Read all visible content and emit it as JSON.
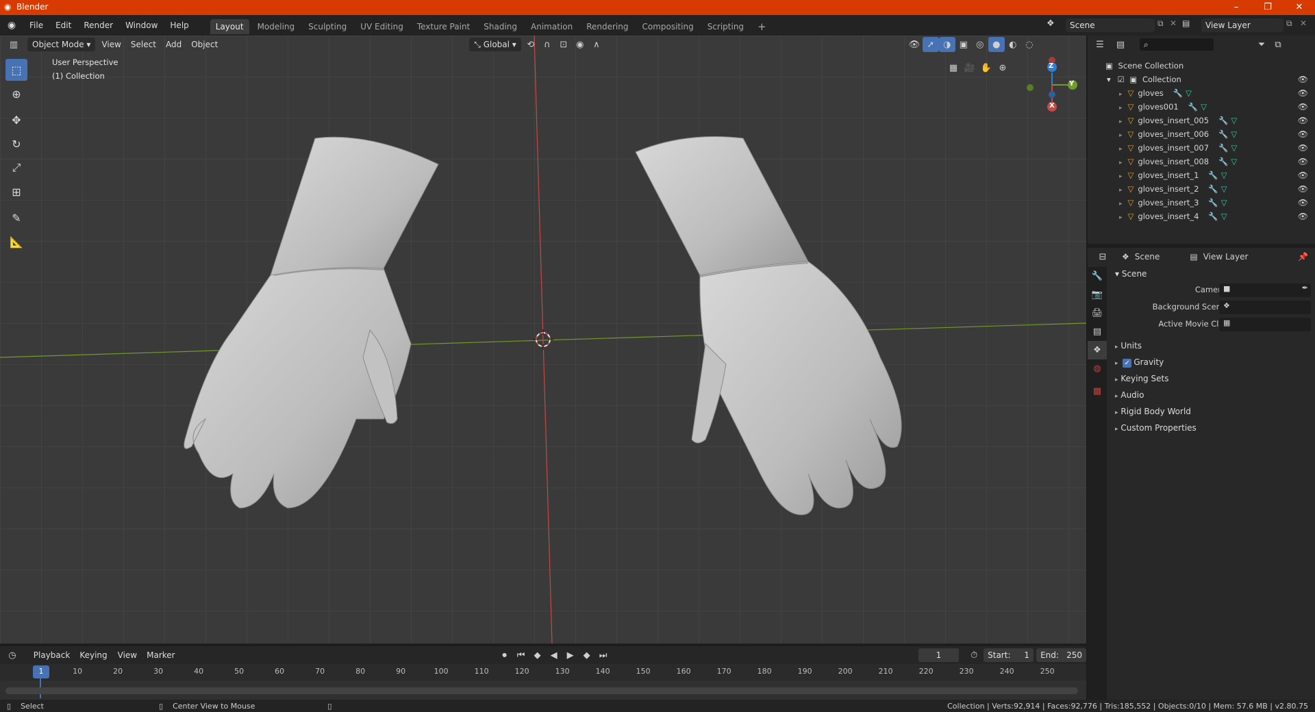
{
  "window": {
    "title": "Blender",
    "controls": [
      "–",
      "❐",
      "✕"
    ]
  },
  "menu": [
    "File",
    "Edit",
    "Render",
    "Window",
    "Help"
  ],
  "workspaces": [
    {
      "label": "Layout",
      "active": true
    },
    {
      "label": "Modeling"
    },
    {
      "label": "Sculpting"
    },
    {
      "label": "UV Editing"
    },
    {
      "label": "Texture Paint"
    },
    {
      "label": "Shading"
    },
    {
      "label": "Animation"
    },
    {
      "label": "Rendering"
    },
    {
      "label": "Compositing"
    },
    {
      "label": "Scripting"
    }
  ],
  "add_workspace": "+",
  "scene_field": "Scene",
  "view_layer_field": "View Layer",
  "viewport": {
    "mode": "Object Mode",
    "menus": [
      "View",
      "Select",
      "Add",
      "Object"
    ],
    "orientation": "Global",
    "info_line1": "User Perspective",
    "info_line2": "(1) Collection",
    "gizmo": {
      "z": "Z",
      "y": "Y",
      "x": "X"
    }
  },
  "outliner": {
    "root": "Scene Collection",
    "collection": "Collection",
    "items": [
      "gloves",
      "gloves001",
      "gloves_insert_005",
      "gloves_insert_006",
      "gloves_insert_007",
      "gloves_insert_008",
      "gloves_insert_1",
      "gloves_insert_2",
      "gloves_insert_3",
      "gloves_insert_4"
    ]
  },
  "properties": {
    "header_scene": "Scene",
    "header_view_layer": "View Layer",
    "section": "Scene",
    "rows": [
      {
        "label": "Camera"
      },
      {
        "label": "Background Scene"
      },
      {
        "label": "Active Movie Clip"
      }
    ],
    "subsections": [
      {
        "label": "Units",
        "check": false
      },
      {
        "label": "Gravity",
        "check": true
      },
      {
        "label": "Keying Sets",
        "check": false
      },
      {
        "label": "Audio",
        "check": false
      },
      {
        "label": "Rigid Body World",
        "check": false
      },
      {
        "label": "Custom Properties",
        "check": false
      }
    ]
  },
  "timeline": {
    "menus": [
      "Playback",
      "Keying",
      "View",
      "Marker"
    ],
    "current_frame": "1",
    "start_label": "Start:",
    "start": "1",
    "end_label": "End:",
    "end": "250",
    "ticks": [
      "1",
      "10",
      "20",
      "30",
      "40",
      "50",
      "60",
      "70",
      "80",
      "90",
      "100",
      "110",
      "120",
      "130",
      "140",
      "150",
      "160",
      "170",
      "180",
      "190",
      "200",
      "210",
      "220",
      "230",
      "240",
      "250"
    ]
  },
  "status": {
    "left1": "Select",
    "left2": "Center View to Mouse",
    "right": "Collection | Verts:92,914 | Faces:92,776 | Tris:185,552 | Objects:0/10 | Mem: 57.6 MB | v2.80.75"
  },
  "colors": {
    "title_bar": "#d83b01",
    "accent": "#4772b3",
    "x_axis": "#c84848",
    "y_axis": "#6f9c2a",
    "z_axis": "#2f7fd6"
  }
}
